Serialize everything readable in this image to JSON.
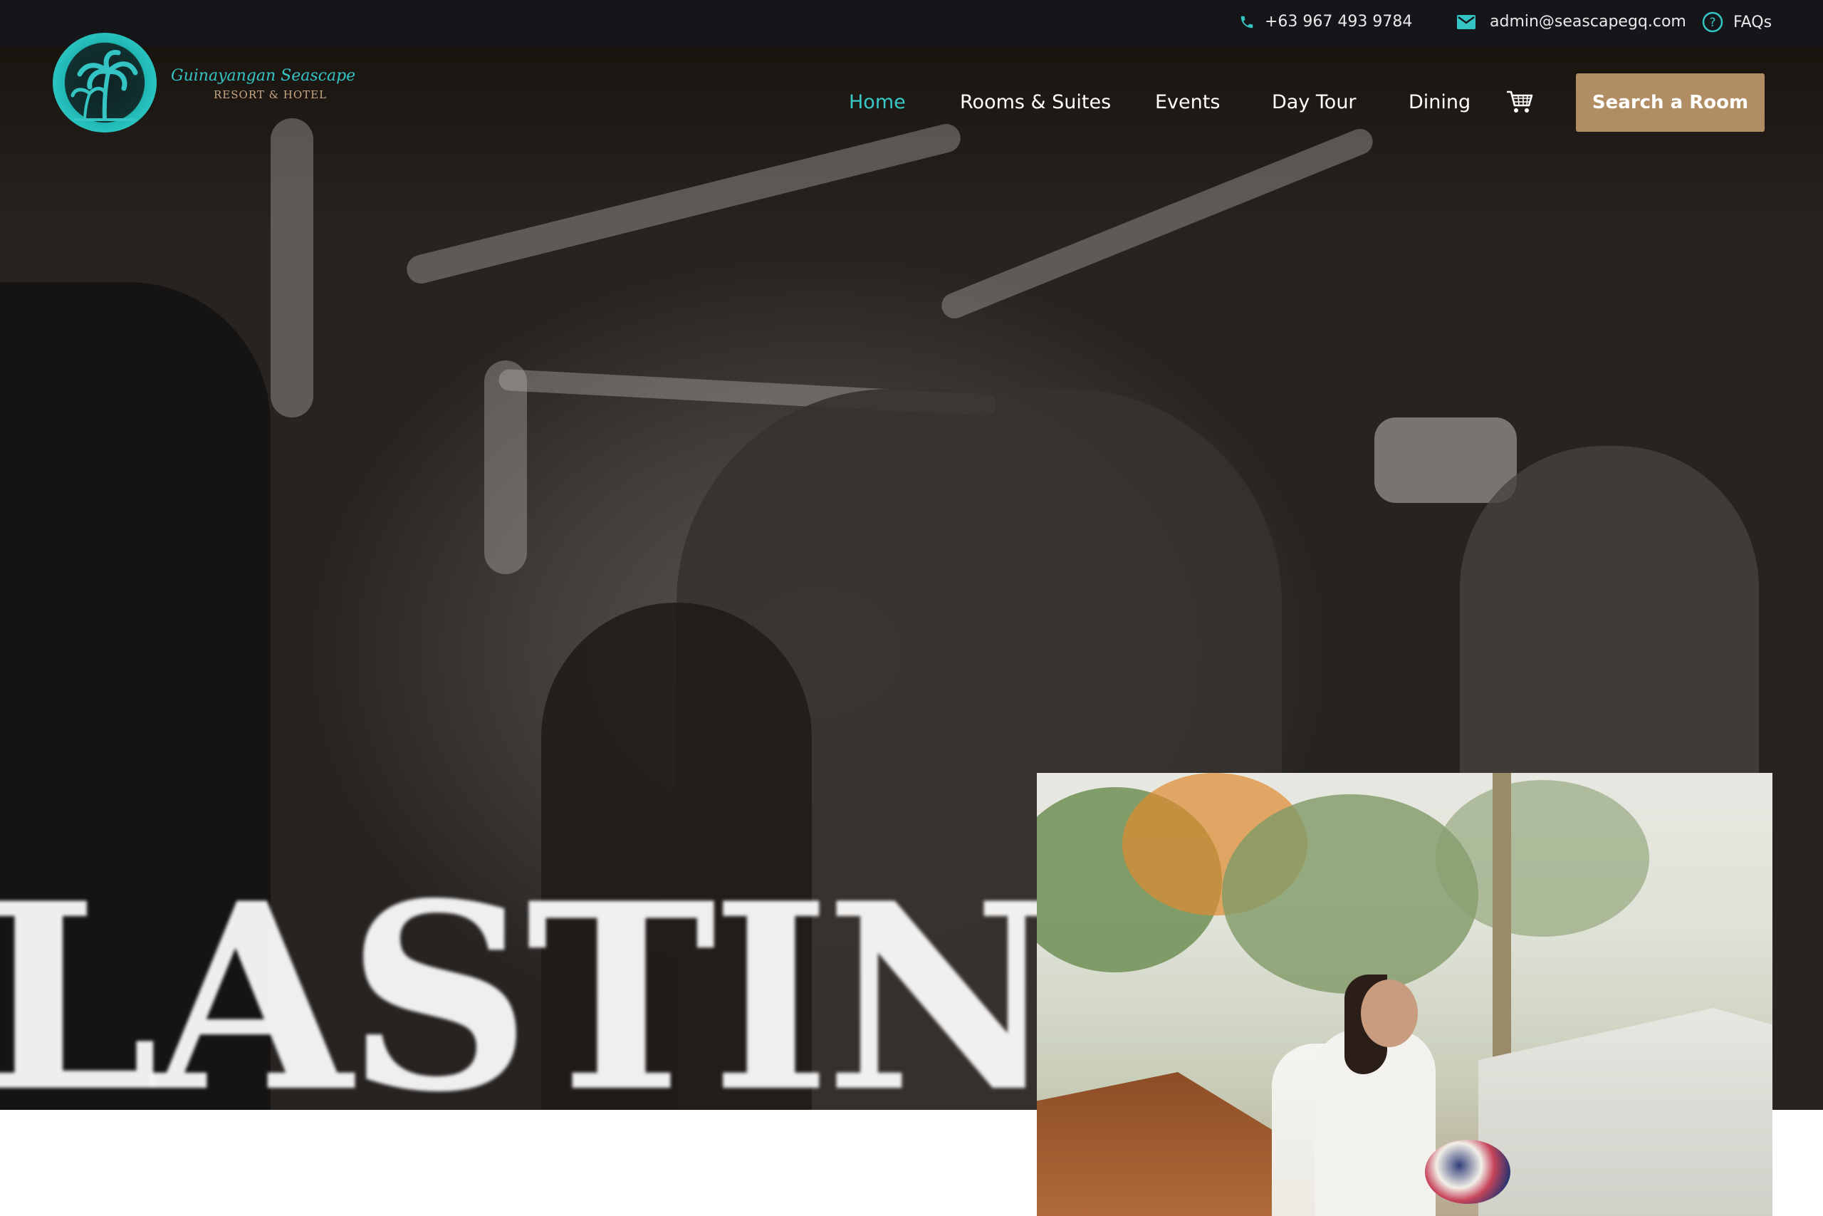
{
  "topbar": {
    "phone": "+63 967 493 9784",
    "email": "admin@seascapegq.com",
    "faqs": "FAQs",
    "icons": [
      "phone-icon",
      "mail-icon",
      "help-circle-icon"
    ]
  },
  "brand": {
    "name": "Guinayangan Seascape",
    "tagline": "RESORT & HOTEL"
  },
  "nav": {
    "items": [
      {
        "label": "Home",
        "active": true
      },
      {
        "label": "Rooms & Suites",
        "active": false
      },
      {
        "label": "Events",
        "active": false
      },
      {
        "label": "Day Tour",
        "active": false
      },
      {
        "label": "Dining",
        "active": false
      }
    ],
    "cart_icon": "shopping-cart-icon",
    "cta_label": "Search a Room"
  },
  "hero": {
    "headline": "LASTING C"
  },
  "colors": {
    "topbar_bg": "#15161a",
    "accent_teal": "#38c8c8",
    "cta_gold": "#b08d62"
  }
}
